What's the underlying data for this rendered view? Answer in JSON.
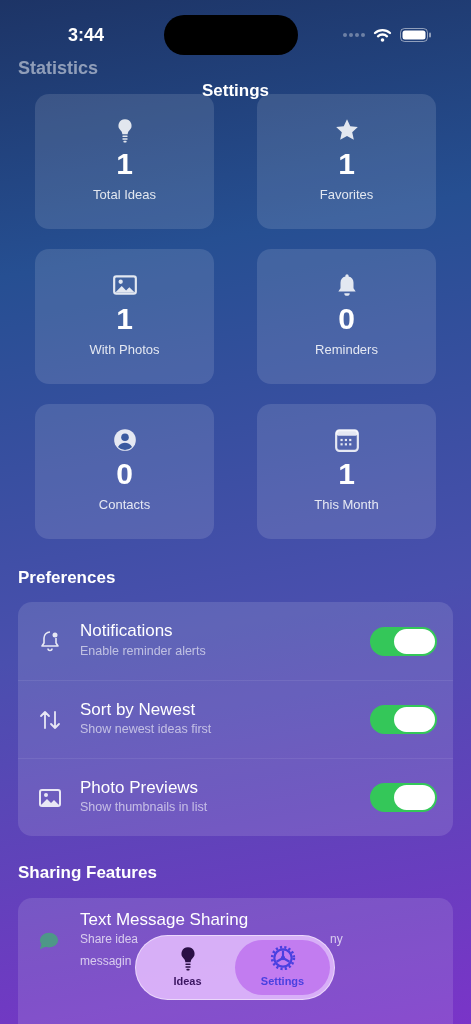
{
  "status_bar": {
    "time": "3:44"
  },
  "background_texts": {
    "section": "Statistics"
  },
  "nav": {
    "title": "Settings"
  },
  "stats": [
    {
      "value": "1",
      "label": "Total Ideas"
    },
    {
      "value": "1",
      "label": "Favorites"
    },
    {
      "value": "1",
      "label": "With Photos"
    },
    {
      "value": "0",
      "label": "Reminders"
    },
    {
      "value": "0",
      "label": "Contacts"
    },
    {
      "value": "1",
      "label": "This Month"
    }
  ],
  "preferences": {
    "title": "Preferences",
    "items": [
      {
        "title": "Notifications",
        "subtitle": "Enable reminder alerts",
        "on": true
      },
      {
        "title": "Sort by Newest",
        "subtitle": "Show newest ideas first",
        "on": true
      },
      {
        "title": "Photo Previews",
        "subtitle": "Show thumbnails in list",
        "on": true
      }
    ]
  },
  "sharing": {
    "title": "Sharing Features",
    "items": [
      {
        "title": "Text Message Sharing",
        "subtitle_parts": [
          "Share idea",
          "ny",
          "messagin"
        ]
      }
    ]
  },
  "tab_bar": [
    {
      "label": "Ideas",
      "selected": false
    },
    {
      "label": "Settings",
      "selected": true
    }
  ]
}
